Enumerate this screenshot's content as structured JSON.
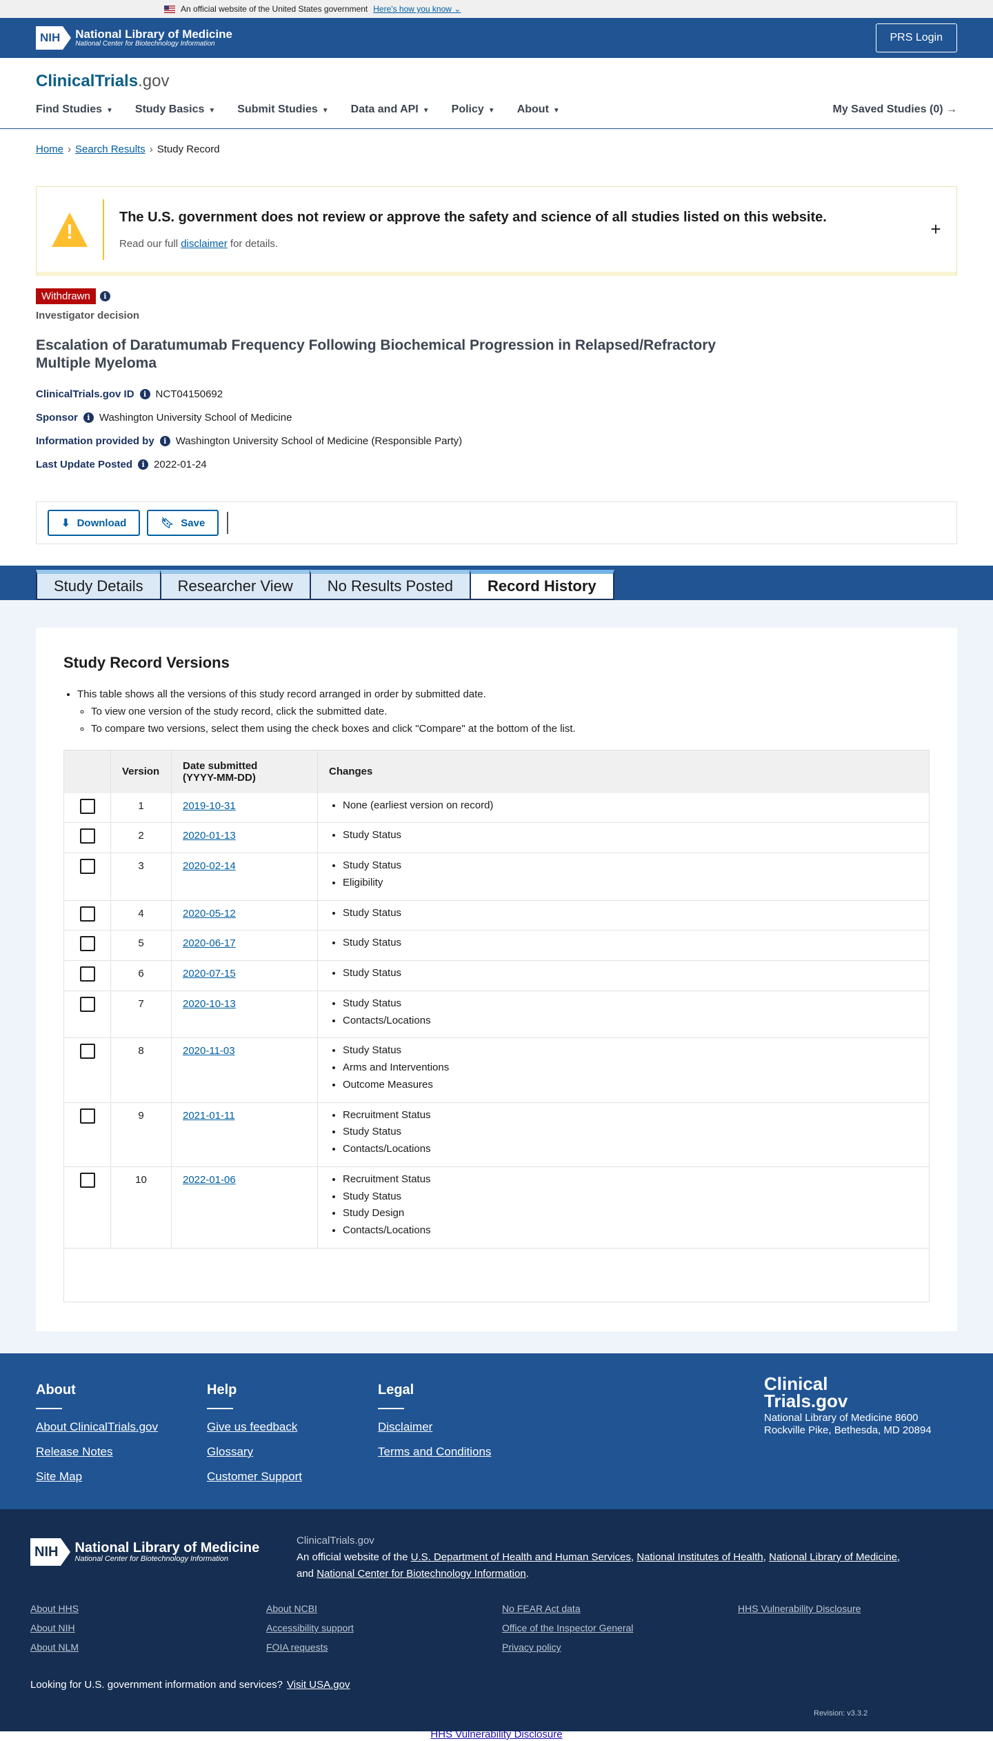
{
  "gov_banner": {
    "text": "An official website of the United States government",
    "link": "Here's how you know"
  },
  "nih_header": {
    "brand_box": "NIH",
    "title": "National Library of Medicine",
    "subtitle": "National Center for Biotechnology Information",
    "prs_login": "PRS Login"
  },
  "site": {
    "logo_main": "ClinicalTrials",
    "logo_suffix": ".gov"
  },
  "nav": {
    "items": [
      "Find Studies",
      "Study Basics",
      "Submit Studies",
      "Data and API",
      "Policy",
      "About"
    ],
    "saved": "My Saved Studies (0)"
  },
  "breadcrumb": {
    "home": "Home",
    "search": "Search Results",
    "current": "Study Record"
  },
  "disclaimer": {
    "title": "The U.S. government does not review or approve the safety and science of all studies listed on this website.",
    "prefix": "Read our full ",
    "link": "disclaimer",
    "suffix": " for details."
  },
  "study": {
    "status": "Withdrawn",
    "reason": "Investigator decision",
    "title": "Escalation of Daratumumab Frequency Following Biochemical Progression in Relapsed/Refractory Multiple Myeloma",
    "id_label": "ClinicalTrials.gov ID",
    "id": "NCT04150692",
    "sponsor_label": "Sponsor",
    "sponsor": "Washington University School of Medicine",
    "provided_label": "Information provided by",
    "provided": "Washington University School of Medicine (Responsible Party)",
    "updated_label": "Last Update Posted",
    "updated": "2022-01-24"
  },
  "actions": {
    "download": "Download",
    "save": "Save"
  },
  "tabs": [
    "Study Details",
    "Researcher View",
    "No Results Posted",
    "Record History"
  ],
  "versions": {
    "heading": "Study Record Versions",
    "bullet_main": "This table shows all the versions of this study record arranged in order by submitted date.",
    "bullet_sub1": "To view one version of the study record, click the submitted date.",
    "bullet_sub2": "To compare two versions, select them using the check boxes and click \"Compare\" at the bottom of the list.",
    "col_version": "Version",
    "col_date_line1": "Date submitted",
    "col_date_line2": "(YYYY-MM-DD)",
    "col_changes": "Changes",
    "rows": [
      {
        "version": "1",
        "date": "2019-10-31",
        "changes": [
          "None (earliest version on record)"
        ]
      },
      {
        "version": "2",
        "date": "2020-01-13",
        "changes": [
          "Study Status"
        ]
      },
      {
        "version": "3",
        "date": "2020-02-14",
        "changes": [
          "Study Status",
          "Eligibility"
        ]
      },
      {
        "version": "4",
        "date": "2020-05-12",
        "changes": [
          "Study Status"
        ]
      },
      {
        "version": "5",
        "date": "2020-06-17",
        "changes": [
          "Study Status"
        ]
      },
      {
        "version": "6",
        "date": "2020-07-15",
        "changes": [
          "Study Status"
        ]
      },
      {
        "version": "7",
        "date": "2020-10-13",
        "changes": [
          "Study Status",
          "Contacts/Locations"
        ]
      },
      {
        "version": "8",
        "date": "2020-11-03",
        "changes": [
          "Study Status",
          "Arms and Interventions",
          "Outcome Measures"
        ]
      },
      {
        "version": "9",
        "date": "2021-01-11",
        "changes": [
          "Recruitment Status",
          "Study Status",
          "Contacts/Locations"
        ]
      },
      {
        "version": "10",
        "date": "2022-01-06",
        "changes": [
          "Recruitment Status",
          "Study Status",
          "Study Design",
          "Contacts/Locations"
        ]
      }
    ]
  },
  "footer": {
    "about": {
      "heading": "About",
      "links": [
        "About ClinicalTrials.gov",
        "Release Notes",
        "Site Map"
      ]
    },
    "help": {
      "heading": "Help",
      "links": [
        "Give us feedback",
        "Glossary",
        "Customer Support"
      ]
    },
    "legal": {
      "heading": "Legal",
      "links": [
        "Disclaimer",
        "Terms and Conditions"
      ]
    },
    "brand_line1": "Clinical",
    "brand_line2": "Trials.gov",
    "address": "National Library of Medicine 8600 Rockville Pike, Bethesda, MD 20894"
  },
  "footer2": {
    "nih_box": "NIH",
    "nih_title": "National Library of Medicine",
    "nih_subtitle": "National Center for Biotechnology Information",
    "site_name": "ClinicalTrials.gov",
    "official_prefix": "An official website of the ",
    "hhs": "U.S. Department of Health and Human Services",
    "nih": "National Institutes of Health",
    "nlm": "National Library of Medicine",
    "and": "and ",
    "ncbi": "National Center for Biotechnology Information",
    "links": [
      "About HHS",
      "About NCBI",
      "No FEAR Act data",
      "HHS Vulnerability Disclosure",
      "About NIH",
      "Accessibility support",
      "Office of the Inspector General",
      "About NLM",
      "FOIA requests",
      "Privacy policy"
    ],
    "gov_question": "Looking for U.S. government information and services?",
    "gov_link": "Visit USA.gov",
    "revision": "Revision: v3.3.2"
  },
  "bottom_link": "HHS Vulnerability Disclosure"
}
